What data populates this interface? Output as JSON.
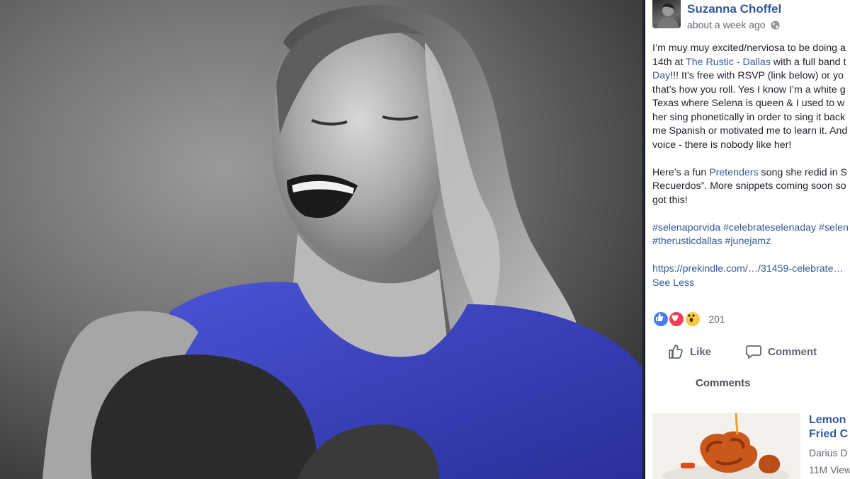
{
  "video": {
    "description_icon": "video-frame"
  },
  "post": {
    "author": "Suzanna Choffel",
    "timestamp": "about a week ago",
    "privacy_icon": "globe-icon",
    "paragraph1": [
      {
        "parts": [
          {
            "t": "I’m muy muy excited/nerviosa to be doing a"
          }
        ]
      },
      {
        "parts": [
          {
            "t": "14th at "
          },
          {
            "t": "The Rustic - Dallas",
            "link": true
          },
          {
            "t": " with a full band t"
          }
        ]
      },
      {
        "parts": [
          {
            "t": "Day",
            "link": true
          },
          {
            "t": "!!! It’s free with RSVP (link below) or yo"
          }
        ]
      },
      {
        "parts": [
          {
            "t": "that’s how you roll. Yes I know I’m a white g"
          }
        ]
      },
      {
        "parts": [
          {
            "t": "Texas where Selena is queen & I used to w"
          }
        ]
      },
      {
        "parts": [
          {
            "t": "her sing phonetically in order to sing it back"
          }
        ]
      },
      {
        "parts": [
          {
            "t": "me Spanish or motivated me to learn it. And"
          }
        ]
      },
      {
        "parts": [
          {
            "t": "voice - there is nobody like her!"
          }
        ]
      }
    ],
    "paragraph2": [
      {
        "parts": [
          {
            "t": "Here’s a fun "
          },
          {
            "t": "Pretenders",
            "link": true
          },
          {
            "t": " song she redid in S"
          }
        ]
      },
      {
        "parts": [
          {
            "t": "Recuerdos”. More snippets coming soon so"
          }
        ]
      },
      {
        "parts": [
          {
            "t": "got this!"
          }
        ]
      }
    ],
    "hashtags": [
      {
        "parts": [
          {
            "t": "#selenaporvida #celebrateselenaday #selen",
            "link": true
          }
        ]
      },
      {
        "parts": [
          {
            "t": "#therusticdallas #junejamz",
            "link": true
          }
        ]
      }
    ],
    "url": "https://prekindle.com/…/31459-celebrate…",
    "see_less": "See Less"
  },
  "reactions": {
    "types": [
      "like-reaction-icon",
      "love-reaction-icon",
      "wow-reaction-icon"
    ],
    "count": "201"
  },
  "actions": {
    "like": "Like",
    "comment": "Comment"
  },
  "comments_title": "Comments",
  "recommended": {
    "title_line1": "Lemon",
    "title_line2": "Fried C",
    "author": "Darius D",
    "views": "11M View"
  },
  "colors": {
    "link": "#365899",
    "text": "#1d2129",
    "muted": "#616770",
    "shirt": "#3d46c9"
  }
}
